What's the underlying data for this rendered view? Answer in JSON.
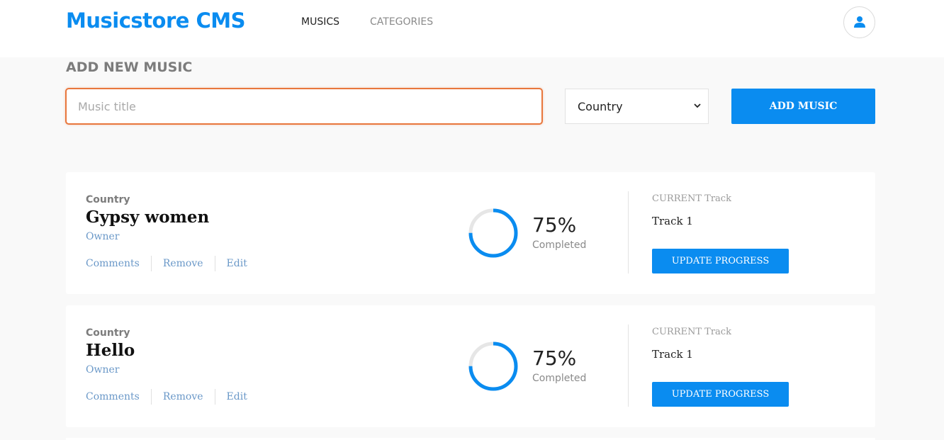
{
  "header": {
    "brand": "Musicstore CMS",
    "nav": [
      {
        "label": "MUSICS",
        "active": true
      },
      {
        "label": "CATEGORIES",
        "active": false
      }
    ],
    "user_icon": "user-icon"
  },
  "add_form": {
    "section_title": "ADD NEW MUSIC",
    "title_placeholder": "Music title",
    "title_value": "",
    "category_selected": "Country",
    "submit_label": "ADD MUSIC"
  },
  "musics": [
    {
      "genre": "Country",
      "title": "Gypsy women",
      "owner": "Owner",
      "actions": {
        "comments": "Comments",
        "remove": "Remove",
        "edit": "Edit"
      },
      "progress": 0.75,
      "progress_label": "75%",
      "completed_label": "Completed",
      "current_track_label": "CURRENT Track",
      "current_track": "Track 1",
      "update_label": "UPDATE PROGRESS"
    },
    {
      "genre": "Country",
      "title": "Hello",
      "owner": "Owner",
      "actions": {
        "comments": "Comments",
        "remove": "Remove",
        "edit": "Edit"
      },
      "progress": 0.75,
      "progress_label": "75%",
      "completed_label": "Completed",
      "current_track_label": "CURRENT Track",
      "current_track": "Track 1",
      "update_label": "UPDATE PROGRESS"
    }
  ],
  "colors": {
    "accent": "#0a8cf0",
    "focus_border": "#e8773d",
    "link": "#6a98c8",
    "ring_track": "#e6e6e6"
  }
}
